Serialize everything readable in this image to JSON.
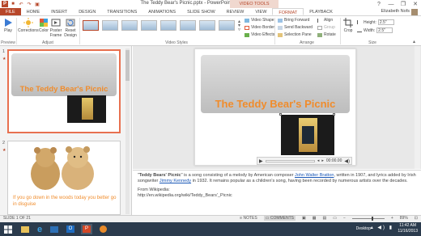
{
  "window": {
    "title": "The Teddy Bear's Picnic.pptx - PowerPoint",
    "context_tab_group": "VIDEO TOOLS",
    "controls": [
      "?",
      "—",
      "❐",
      "✕"
    ]
  },
  "tabs": [
    "FILE",
    "HOME",
    "INSERT",
    "DESIGN",
    "TRANSITIONS",
    "ANIMATIONS",
    "SLIDE SHOW",
    "REVIEW",
    "VIEW",
    "FORMAT",
    "PLAYBACK"
  ],
  "active_tab": "FORMAT",
  "user": {
    "name": "Elizabeth Nofs"
  },
  "ribbon": {
    "preview": {
      "play": "Play",
      "group": "Preview"
    },
    "adjust": {
      "corrections": "Corrections",
      "color": "Color",
      "poster_frame": "Poster Frame",
      "reset_design": "Reset Design",
      "group": "Adjust"
    },
    "video_styles": {
      "group": "Video Styles",
      "shape": "Video Shape",
      "border": "Video Border",
      "effects": "Video Effects"
    },
    "arrange": {
      "bring_forward": "Bring Forward",
      "send_backward": "Send Backward",
      "selection_pane": "Selection Pane",
      "align": "Align",
      "group_btn": "Group",
      "rotate": "Rotate",
      "group": "Arrange"
    },
    "size": {
      "crop": "Crop",
      "height_label": "Height:",
      "height": "2.5\"",
      "width_label": "Width:",
      "width": "2.5\"",
      "group": "Size"
    }
  },
  "slides": {
    "panel": [
      {
        "number": "1",
        "title": "The Teddy Bear's Picnic"
      },
      {
        "number": "2",
        "caption": "If you go down in the woods today you better go in disguise"
      }
    ],
    "main_title": "The Teddy Bear's Picnic"
  },
  "video": {
    "time": "00:00.00"
  },
  "notes": {
    "quote": "\"",
    "song_name": "Teddy Bears' Picnic",
    "p1a": "\" is a song consisting of a melody by American composer ",
    "composer": "John Walter Bratton",
    "p1b": ", written in 1907, and lyrics added by Irish songwriter ",
    "lyricist": "Jimmy Kennedy",
    "p1c": " in 1932. It remains popular as a children's song, having been recorded by numerous artists over the decades.",
    "source_label": "From Wikipedia:",
    "source_url": "http://en.wikipedia.org/wiki/Teddy_Bears'_Picnic"
  },
  "status": {
    "slide_info": "SLIDE 1 OF 21",
    "notes": "NOTES",
    "comments": "COMMENTS",
    "zoom": "89%"
  },
  "taskbar": {
    "desktop": "Desktop",
    "time": "11:42 AM",
    "date": "11/16/2013"
  },
  "colors": {
    "accent": "#b7472a",
    "title_orange": "#f08c2c",
    "selection": "#e8704f",
    "taskbar": "#2b3b4d"
  }
}
